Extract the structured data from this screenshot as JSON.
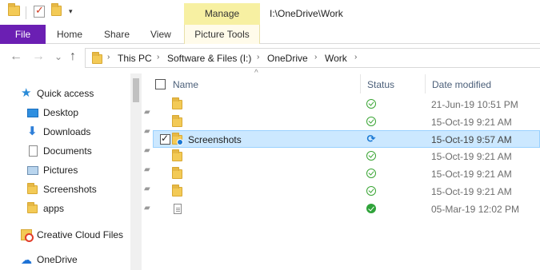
{
  "window": {
    "title": "I:\\OneDrive\\Work",
    "contextual_group": "Manage"
  },
  "quick_access_toolbar": {
    "icons": [
      "folder-icon",
      "properties-icon",
      "new-folder-icon",
      "customize-dropdown-icon"
    ],
    "dropdown_glyph": "▾"
  },
  "ribbon": {
    "tabs": [
      {
        "label": "File"
      },
      {
        "label": "Home"
      },
      {
        "label": "Share"
      },
      {
        "label": "View"
      },
      {
        "label": "Picture Tools"
      }
    ],
    "accent_color": "#6b1fb3",
    "manage_color": "#f7f0a2"
  },
  "address_bar": {
    "back_glyph": "←",
    "forward_glyph": "→",
    "recent_glyph": "⌄",
    "up_glyph": "↑",
    "crumbs": [
      "This PC",
      "Software & Files (I:)",
      "OneDrive",
      "Work"
    ],
    "chevron": "›"
  },
  "nav_pane": {
    "quick_access": "Quick access",
    "items": [
      {
        "label": "Desktop",
        "icon": "desktop-icon",
        "pinned": true
      },
      {
        "label": "Downloads",
        "icon": "downloads-icon",
        "pinned": true
      },
      {
        "label": "Documents",
        "icon": "documents-icon",
        "pinned": true
      },
      {
        "label": "Pictures",
        "icon": "pictures-icon",
        "pinned": true
      },
      {
        "label": "Screenshots",
        "icon": "folder-icon",
        "pinned": true
      },
      {
        "label": "apps",
        "icon": "folder-icon",
        "pinned": true
      }
    ],
    "creative_cloud": "Creative Cloud Files",
    "onedrive": "OneDrive",
    "pin_glyph": "📌"
  },
  "file_list": {
    "sort_glyph": "^",
    "columns": {
      "name": "Name",
      "status": "Status",
      "date_modified": "Date modified"
    },
    "rows": [
      {
        "name": "",
        "type": "folder",
        "status": "available",
        "date": "21-Jun-19 10:51 PM",
        "selected": false
      },
      {
        "name": "",
        "type": "folder",
        "status": "available",
        "date": "15-Oct-19 9:21 AM",
        "selected": false
      },
      {
        "name": "Screenshots",
        "type": "folder",
        "status": "syncing",
        "date": "15-Oct-19 9:57 AM",
        "selected": true
      },
      {
        "name": "",
        "type": "folder",
        "status": "available",
        "date": "15-Oct-19 9:21 AM",
        "selected": false
      },
      {
        "name": "",
        "type": "folder",
        "status": "available",
        "date": "15-Oct-19 9:21 AM",
        "selected": false
      },
      {
        "name": "",
        "type": "folder",
        "status": "available",
        "date": "15-Oct-19 9:21 AM",
        "selected": false
      },
      {
        "name": "",
        "type": "file",
        "status": "always-available",
        "date": "05-Mar-19 12:02 PM",
        "selected": false
      }
    ],
    "sync_glyph": "⟳",
    "selection_color": "#cce8ff"
  }
}
